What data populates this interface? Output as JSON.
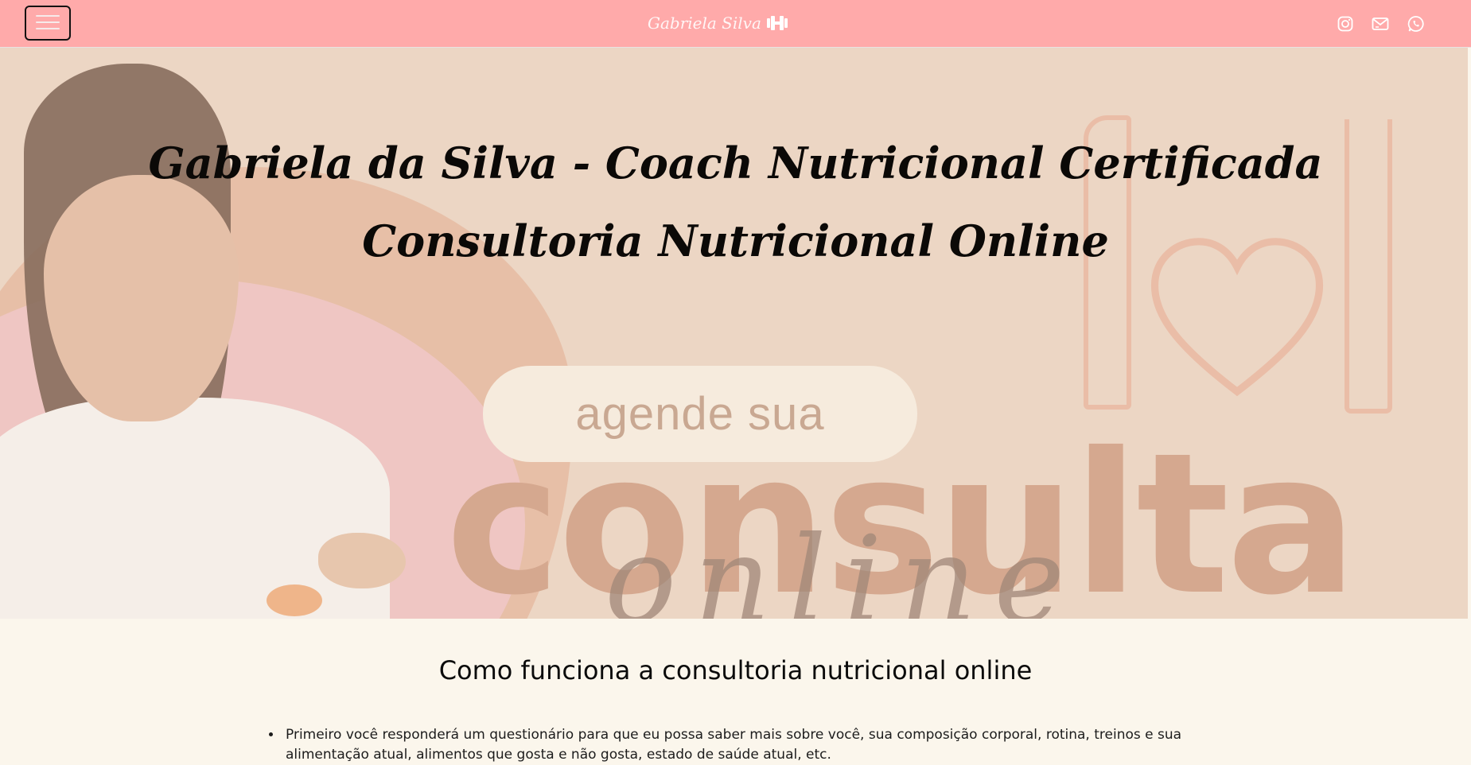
{
  "navbar": {
    "menu_icon": "hamburger-menu-icon",
    "brand": "Gabriela Silva",
    "brand_icon": "dumbbell-icon",
    "social": [
      {
        "name": "instagram-icon"
      },
      {
        "name": "email-icon"
      },
      {
        "name": "whatsapp-icon"
      }
    ],
    "bg_color": "#ffaaaa"
  },
  "hero": {
    "title_line1": "Gabriela da Silva - Coach Nutricional Certificada",
    "title_line2": "Consultoria Nutricional Online",
    "banner": {
      "pill_text": "agende sua",
      "big_word": "consulta",
      "script_word": "online"
    }
  },
  "section": {
    "title": "Como funciona a consultoria nutricional online",
    "steps": [
      "Primeiro você responderá um questionário para que eu possa saber mais sobre você, sua composição corporal, rotina, treinos e sua alimentação atual, alimentos que gosta e não gosta, estado de saúde atual, etc."
    ]
  }
}
